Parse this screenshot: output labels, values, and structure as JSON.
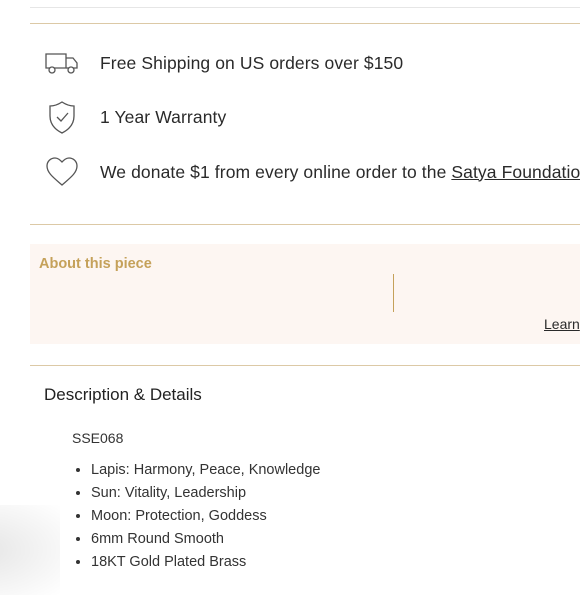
{
  "perks": [
    {
      "icon": "truck-icon",
      "text": "Free Shipping on US orders over $150"
    },
    {
      "icon": "shield-check-icon",
      "text": "1 Year Warranty"
    },
    {
      "icon": "heart-icon",
      "text": "We donate $1 from every online order to the ",
      "link": "Satya Foundation"
    }
  ],
  "about": {
    "title": "About this piece",
    "link": "Learn"
  },
  "description": {
    "title": "Description & Details",
    "sku": "SSE068",
    "items": [
      "Lapis: Harmony, Peace, Knowledge",
      "Sun: Vitality, Leadership",
      "Moon: Protection, Goddess",
      "6mm Round Smooth",
      "18KT Gold Plated Brass"
    ]
  },
  "colors": {
    "accent_gold": "#c5a15a",
    "divider_gold": "#dcc9a6",
    "about_bg": "#fdf6f2"
  }
}
